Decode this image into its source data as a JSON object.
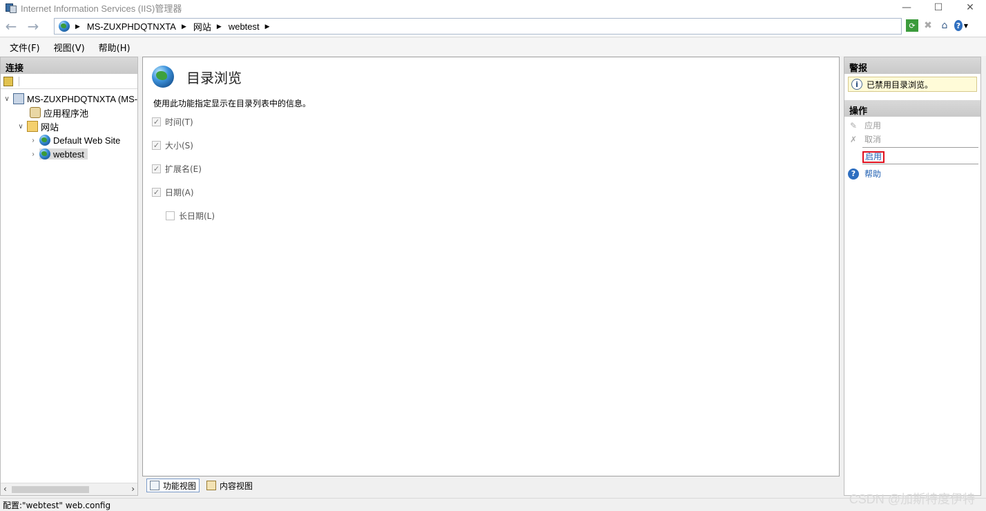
{
  "window": {
    "title": "Internet Information Services (IIS)管理器",
    "min": "—",
    "max": "☐",
    "close": "✕"
  },
  "nav": {
    "back": "←",
    "forward": "→",
    "breadcrumb": [
      "MS-ZUXPHDQTNXTA",
      "网站",
      "webtest"
    ]
  },
  "menus": [
    "文件(F)",
    "视图(V)",
    "帮助(H)"
  ],
  "connections": {
    "title": "连接",
    "tree": {
      "server": "MS-ZUXPHDQTNXTA (MS-",
      "app_pools": "应用程序池",
      "sites": "网站",
      "default_site": "Default Web Site",
      "webtest": "webtest"
    }
  },
  "feature": {
    "title": "目录浏览",
    "description": "使用此功能指定显示在目录列表中的信息。",
    "options": [
      {
        "label": "时间(T)",
        "checked": true
      },
      {
        "label": "大小(S)",
        "checked": true
      },
      {
        "label": "扩展名(E)",
        "checked": true
      },
      {
        "label": "日期(A)",
        "checked": true
      },
      {
        "label": "长日期(L)",
        "checked": false
      }
    ]
  },
  "view_tabs": {
    "features": "功能视图",
    "content": "内容视图"
  },
  "alerts": {
    "title": "警报",
    "message": "已禁用目录浏览。"
  },
  "actions": {
    "title": "操作",
    "apply": "应用",
    "cancel": "取消",
    "enable": "启用",
    "help": "帮助"
  },
  "status": {
    "text": "配置:\"webtest\" web.config"
  },
  "watermark": "CSDN @加斯特度伊特"
}
